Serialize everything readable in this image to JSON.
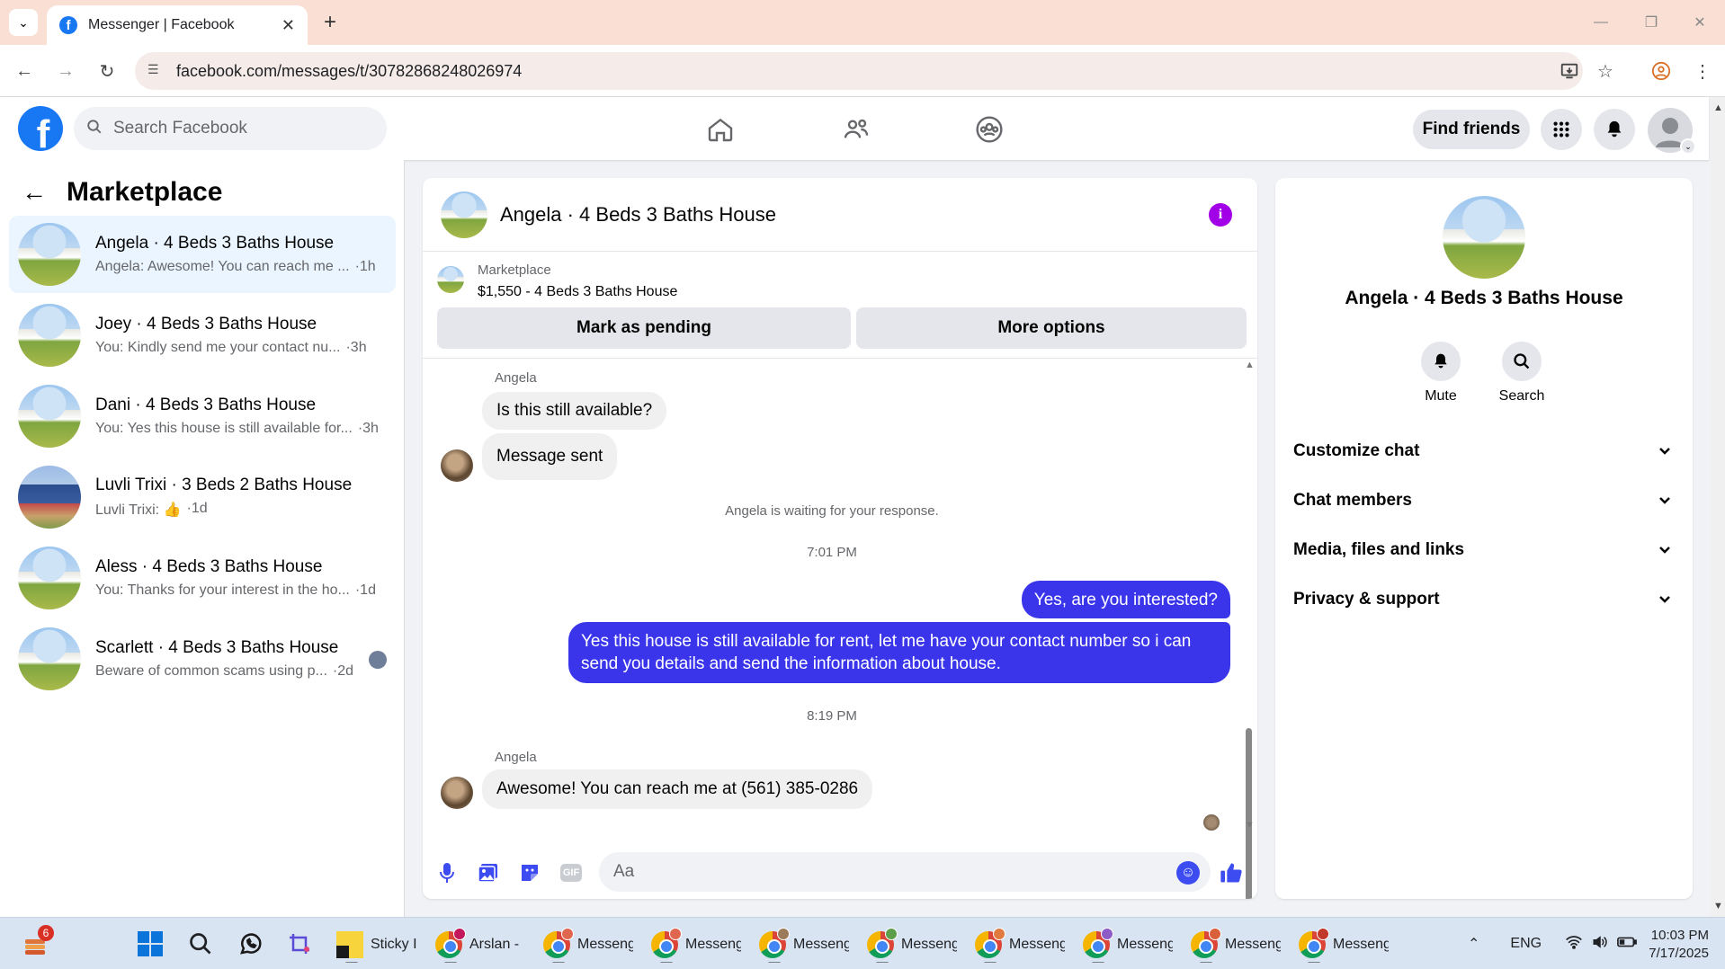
{
  "browser": {
    "tab_title": "Messenger | Facebook",
    "url": "facebook.com/messages/t/30782868248026974"
  },
  "fbnav": {
    "search_placeholder": "Search Facebook",
    "find_friends": "Find friends"
  },
  "left": {
    "title": "Marketplace",
    "conversations": [
      {
        "name": "Angela · 4 Beds 3 Baths House",
        "preview": "Angela: Awesome! You can reach me ...",
        "ago": "·1h"
      },
      {
        "name": "Joey · 4 Beds 3 Baths House",
        "preview": "You: Kindly send me your contact nu...",
        "ago": "·3h"
      },
      {
        "name": "Dani · 4 Beds 3 Baths House",
        "preview": "You: Yes this house is still available for...",
        "ago": "·3h"
      },
      {
        "name": "Luvli Trixi · 3 Beds 2 Baths House",
        "preview": "Luvli Trixi: 👍",
        "ago": "·1d"
      },
      {
        "name": "Aless · 4 Beds 3 Baths House",
        "preview": "You: Thanks for your interest in the ho...",
        "ago": "·1d"
      },
      {
        "name": "Scarlett · 4 Beds 3 Baths House",
        "preview": "Beware of common scams using p...",
        "ago": "·2d"
      }
    ]
  },
  "chat": {
    "title": "Angela · 4 Beds 3 Baths House",
    "marketplace_label": "Marketplace",
    "listing": "$1,550 - 4 Beds 3 Baths House",
    "mark_pending": "Mark as pending",
    "more_options": "More options",
    "messages": {
      "sender1": "Angela",
      "in1": "Is this still available?",
      "in2": "Message sent",
      "waiting": "Angela is waiting for your response.",
      "time1": "7:01 PM",
      "out1": "Yes, are you interested?",
      "out2": "Yes this house is still available for rent, let me have your contact number so i can send you details and send the information about house.",
      "time2": "8:19 PM",
      "sender2": "Angela",
      "in3": "Awesome! You can reach me at (561) 385-0286"
    },
    "composer_placeholder": "Aa",
    "gif_label": "GIF"
  },
  "right": {
    "title": "Angela · 4 Beds 3 Baths House",
    "mute": "Mute",
    "search": "Search",
    "sections": [
      "Customize chat",
      "Chat members",
      "Media, files and links",
      "Privacy & support"
    ]
  },
  "taskbar": {
    "notif_count": "6",
    "apps": [
      {
        "label": "Sticky I"
      },
      {
        "label": "Arslan -"
      },
      {
        "label": "Messeng"
      },
      {
        "label": "Messeng"
      },
      {
        "label": "Messeng"
      },
      {
        "label": "Messeng"
      },
      {
        "label": "Messeng"
      },
      {
        "label": "Messeng"
      },
      {
        "label": "Messeng"
      },
      {
        "label": "Messeng"
      }
    ],
    "lang": "ENG",
    "time": "10:03 PM",
    "date": "7/17/2025"
  },
  "colors": {
    "accent": "#1877f2",
    "outgoing_bubble": "#3a35eb",
    "info_icon": "#a200e6"
  }
}
